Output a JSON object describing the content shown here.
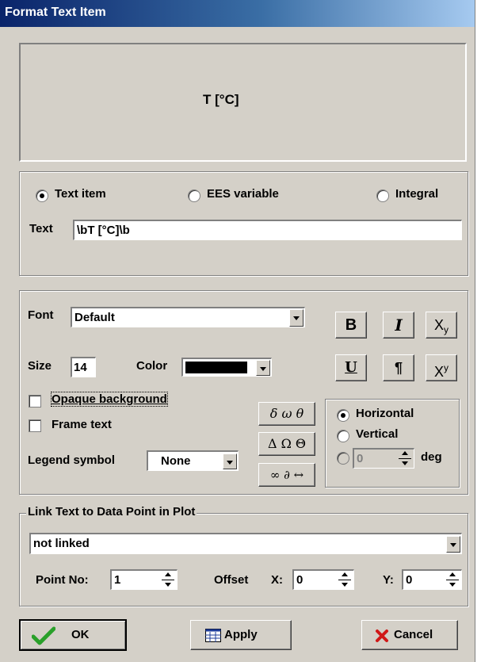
{
  "window": {
    "title": "Format Text Item"
  },
  "preview": {
    "text": "T [°C]"
  },
  "item_type": {
    "options": [
      {
        "label": "Text item",
        "selected": true
      },
      {
        "label": "EES variable",
        "selected": false
      },
      {
        "label": "Integral",
        "selected": false
      }
    ]
  },
  "text_field": {
    "label": "Text",
    "value": "\\bT [°C]\\b"
  },
  "font": {
    "label": "Font",
    "value": "Default"
  },
  "size": {
    "label": "Size",
    "value": "14"
  },
  "color": {
    "label": "Color",
    "value": "#000000"
  },
  "style_buttons": {
    "bold": "B",
    "italic": "I",
    "subscript": "X",
    "subscript_sub": "y",
    "underline": "U",
    "paragraph": "¶",
    "superscript": "X",
    "superscript_sup": "y"
  },
  "opaque_background": {
    "label": "Opaque background",
    "checked": false
  },
  "frame_text": {
    "label": "Frame text",
    "checked": false
  },
  "legend_symbol": {
    "label": "Legend symbol",
    "value": "None"
  },
  "symbol_buttons": {
    "greek_lower": "δ ω θ",
    "greek_upper": "Δ Ω Θ",
    "math": "∞ ∂ ↔"
  },
  "orientation": {
    "horizontal": "Horizontal",
    "vertical": "Vertical",
    "angle_value": "0",
    "angle_unit": "deg",
    "selected": "horizontal"
  },
  "link": {
    "group_title": "Link Text to Data Point in Plot",
    "selection": "not linked",
    "point_label": "Point No:",
    "point_value": "1",
    "offset_label": "Offset",
    "x_label": "X:",
    "x_value": "0",
    "y_label": "Y:",
    "y_value": "0"
  },
  "buttons": {
    "ok": "OK",
    "apply": "Apply",
    "cancel": "Cancel"
  }
}
